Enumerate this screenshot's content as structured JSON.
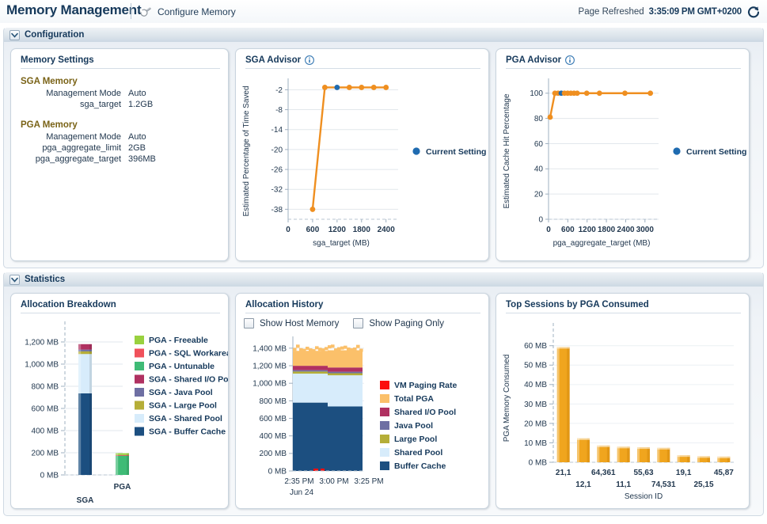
{
  "header": {
    "title": "Memory Management",
    "configure_link": "Configure Memory",
    "wrench_icon": "wrench-icon",
    "refresh_label": "Page Refreshed",
    "refresh_time": "3:35:09 PM GMT+0200",
    "refresh_icon": "refresh-icon"
  },
  "sections": {
    "configuration": {
      "title": "Configuration",
      "twisty": "chevron-down-icon"
    },
    "statistics": {
      "title": "Statistics",
      "twisty": "chevron-down-icon"
    }
  },
  "memory_settings": {
    "title": "Memory Settings",
    "groups": [
      {
        "heading": "SGA Memory",
        "rows": [
          {
            "label": "Management Mode",
            "value": "Auto"
          },
          {
            "label": "sga_target",
            "value": "1.2GB"
          }
        ]
      },
      {
        "heading": "PGA Memory",
        "rows": [
          {
            "label": "Management Mode",
            "value": "Auto"
          },
          {
            "label": "pga_aggregate_limit",
            "value": "2GB"
          },
          {
            "label": "pga_aggregate_target",
            "value": "396MB"
          }
        ]
      }
    ]
  },
  "sga_advisor": {
    "title": "SGA Advisor",
    "info_icon": "info-icon"
  },
  "pga_advisor": {
    "title": "PGA Advisor",
    "info_icon": "info-icon"
  },
  "allocation_breakdown": {
    "title": "Allocation Breakdown"
  },
  "allocation_history": {
    "title": "Allocation History",
    "checkboxes": [
      {
        "label": "Show Host Memory",
        "checked": false
      },
      {
        "label": "Show Paging Only",
        "checked": false
      }
    ]
  },
  "top_sessions": {
    "title": "Top Sessions by PGA Consumed"
  },
  "chart_data": [
    {
      "id": "sga_advisor",
      "type": "line",
      "title": "SGA Advisor",
      "xlabel": "sga_target (MB)",
      "ylabel": "Estimated Percentage of Time Saved",
      "xlim": [
        0,
        2600
      ],
      "ylim": [
        -41,
        0
      ],
      "xticks": [
        0,
        600,
        1200,
        1800,
        2400
      ],
      "yticks": [
        -2,
        -8,
        -14,
        -20,
        -26,
        -32,
        -38
      ],
      "grid": true,
      "legend": [
        {
          "label": "Current Setting",
          "color": "#1f6bb0",
          "marker": "circle"
        }
      ],
      "series": [
        {
          "name": "Estimated Percentage of Time Saved",
          "color": "#ef8f20",
          "points": [
            {
              "x": 600,
              "y": -38.0
            },
            {
              "x": 900,
              "y": -1.3
            },
            {
              "x": 1200,
              "y": -1.3,
              "current": true
            },
            {
              "x": 1500,
              "y": -1.3
            },
            {
              "x": 1800,
              "y": -1.3
            },
            {
              "x": 2100,
              "y": -1.3
            },
            {
              "x": 2400,
              "y": -1.3
            }
          ]
        }
      ]
    },
    {
      "id": "pga_advisor",
      "type": "line",
      "title": "PGA Advisor",
      "xlabel": "pga_aggregate_target (MB)",
      "ylabel": "Estimated Cache Hit Percentage",
      "xlim": [
        0,
        3300
      ],
      "ylim": [
        0,
        108
      ],
      "xticks": [
        0,
        600,
        1200,
        1800,
        2400,
        3000
      ],
      "yticks": [
        0,
        20,
        40,
        60,
        80,
        100
      ],
      "grid": true,
      "legend": [
        {
          "label": "Current Setting",
          "color": "#1f6bb0",
          "marker": "circle"
        }
      ],
      "series": [
        {
          "name": "Estimated Cache Hit Percentage",
          "color": "#ef8f20",
          "points": [
            {
              "x": 50,
              "y": 81
            },
            {
              "x": 198,
              "y": 100
            },
            {
              "x": 297,
              "y": 100
            },
            {
              "x": 396,
              "y": 100,
              "current": true
            },
            {
              "x": 495,
              "y": 100
            },
            {
              "x": 594,
              "y": 100
            },
            {
              "x": 693,
              "y": 100
            },
            {
              "x": 792,
              "y": 100
            },
            {
              "x": 891,
              "y": 100
            },
            {
              "x": 1188,
              "y": 100
            },
            {
              "x": 1584,
              "y": 100
            },
            {
              "x": 2376,
              "y": 100
            },
            {
              "x": 3168,
              "y": 100
            }
          ]
        }
      ]
    },
    {
      "id": "allocation_breakdown",
      "type": "bar",
      "title": "Allocation Breakdown",
      "xlabel": "",
      "ylabel": "",
      "stacked": true,
      "categories": [
        "SGA",
        "PGA"
      ],
      "ylim": [
        0,
        1300
      ],
      "yticks": [
        0,
        200,
        400,
        600,
        800,
        1000,
        1200
      ],
      "ytick_labels": [
        "0 MB",
        "200 MB",
        "400 MB",
        "600 MB",
        "800 MB",
        "1,000 MB",
        "1,200 MB"
      ],
      "legend": [
        {
          "label": "PGA - Freeable",
          "color": "#99d13f"
        },
        {
          "label": "PGA - SQL Workareas",
          "color": "#f0515b"
        },
        {
          "label": "PGA - Untunable",
          "color": "#3fbb76"
        },
        {
          "label": "SGA - Shared I/O Pool",
          "color": "#b03161"
        },
        {
          "label": "SGA - Java Pool",
          "color": "#6e6fa3"
        },
        {
          "label": "SGA - Large Pool",
          "color": "#b5ae38"
        },
        {
          "label": "SGA - Shared Pool",
          "color": "#d7ecfb"
        },
        {
          "label": "SGA - Buffer Cache",
          "color": "#1c4f80"
        }
      ],
      "bars": [
        {
          "category": "SGA",
          "total": 1180,
          "segments": [
            {
              "name": "SGA - Buffer Cache",
              "value": 736,
              "color": "#1c4f80"
            },
            {
              "name": "SGA - Shared Pool",
              "value": 355,
              "color": "#d7ecfb"
            },
            {
              "name": "SGA - Large Pool",
              "value": 24,
              "color": "#b5ae38"
            },
            {
              "name": "SGA - Java Pool",
              "value": 16,
              "color": "#6e6fa3"
            },
            {
              "name": "SGA - Shared I/O Pool",
              "value": 49,
              "color": "#b03161"
            }
          ]
        },
        {
          "category": "PGA",
          "total": 196,
          "segments": [
            {
              "name": "PGA - Untunable",
              "value": 176,
              "color": "#3fbb76"
            },
            {
              "name": "PGA - SQL Workareas",
              "value": 4,
              "color": "#f0515b"
            },
            {
              "name": "PGA - Freeable",
              "value": 16,
              "color": "#99d13f"
            }
          ]
        }
      ]
    },
    {
      "id": "allocation_history",
      "type": "area",
      "title": "Allocation History",
      "xlabel": "",
      "ylabel": "",
      "xtick_labels": [
        "2:35 PM",
        "3:00 PM",
        "3:25 PM"
      ],
      "x_date_label": "Jun 24",
      "ylim": [
        0,
        1480
      ],
      "yticks": [
        0,
        200,
        400,
        600,
        800,
        1000,
        1200,
        1400
      ],
      "ytick_labels": [
        "0 MB",
        "200 MB",
        "400 MB",
        "600 MB",
        "800 MB",
        "1,000 MB",
        "1,200 MB",
        "1,400 MB"
      ],
      "legend": [
        {
          "label": "VM Paging Rate",
          "color": "#fc0d0d"
        },
        {
          "label": "Total PGA",
          "color": "#fbc06a"
        },
        {
          "label": "Shared I/O Pool",
          "color": "#b03161"
        },
        {
          "label": "Java Pool",
          "color": "#6e6fa3"
        },
        {
          "label": "Large Pool",
          "color": "#b5ae38"
        },
        {
          "label": "Shared Pool",
          "color": "#d7ecfb"
        },
        {
          "label": "Buffer Cache",
          "color": "#1c4f80"
        }
      ],
      "series": [
        {
          "name": "Buffer Cache",
          "color": "#1c4f80",
          "values_left": 780,
          "values_right": 736
        },
        {
          "name": "Shared Pool",
          "color": "#d7ecfb",
          "values_left": 330,
          "values_right": 355
        },
        {
          "name": "Large Pool",
          "color": "#b5ae38",
          "values_left": 24,
          "values_right": 24
        },
        {
          "name": "Java Pool",
          "color": "#6e6fa3",
          "values_left": 16,
          "values_right": 16
        },
        {
          "name": "Shared I/O Pool",
          "color": "#b03161",
          "values_left": 49,
          "values_right": 49
        },
        {
          "name": "Total PGA",
          "color": "#fbc06a",
          "values_left": 170,
          "values_right": 196
        },
        {
          "name": "VM Paging Rate",
          "color": "#fc0d0d",
          "values_left": 0,
          "values_right": 0
        }
      ]
    },
    {
      "id": "top_sessions",
      "type": "bar",
      "title": "Top Sessions by PGA Consumed",
      "xlabel": "Session ID",
      "ylabel": "PGA Memory Consumed",
      "categories": [
        "21,1",
        "12,1",
        "64,361",
        "11,1",
        "55,63",
        "74,531",
        "19,1",
        "25,15",
        "45,87"
      ],
      "values": [
        59.3,
        12.3,
        8.6,
        8.0,
        7.7,
        7.4,
        3.6,
        3.1,
        2.9
      ],
      "color": "#f0a51e",
      "ylim": [
        0,
        66
      ],
      "yticks": [
        0,
        10,
        20,
        30,
        40,
        50,
        60
      ],
      "ytick_labels": [
        "0 MB",
        "10 MB",
        "20 MB",
        "30 MB",
        "40 MB",
        "50 MB",
        "60 MB"
      ]
    }
  ]
}
